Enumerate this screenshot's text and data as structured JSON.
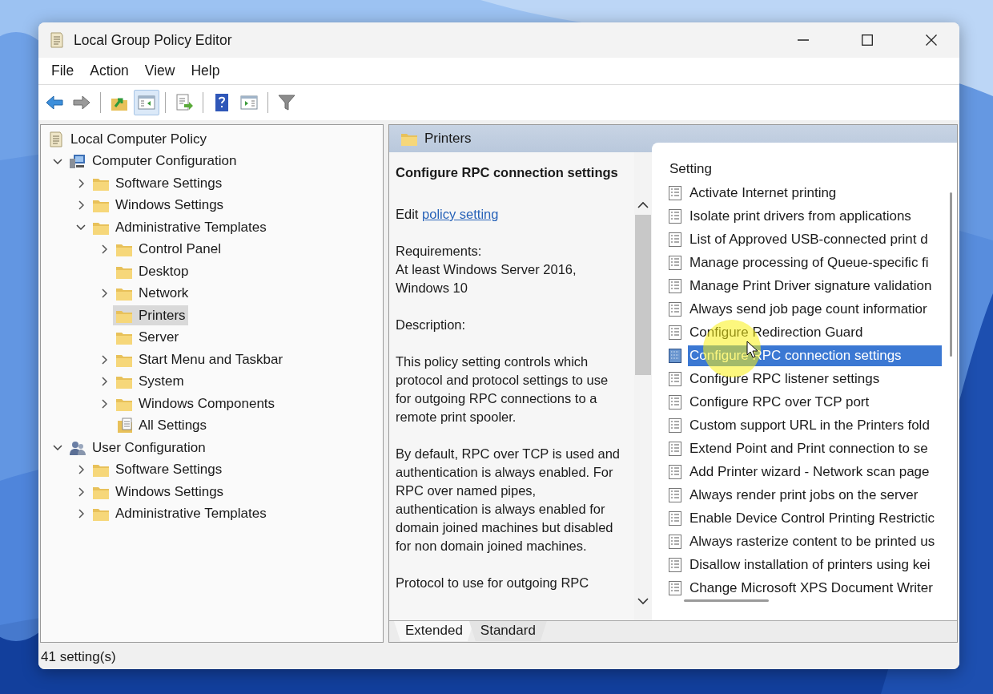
{
  "window": {
    "title": "Local Group Policy Editor"
  },
  "menu": [
    "File",
    "Action",
    "View",
    "Help"
  ],
  "toolbar": [
    [
      {
        "kind": "back",
        "pressed": false
      },
      {
        "kind": "forward",
        "pressed": false
      }
    ],
    [
      {
        "kind": "up",
        "pressed": false
      },
      {
        "kind": "tree",
        "pressed": true
      }
    ],
    [
      {
        "kind": "export",
        "pressed": false
      }
    ],
    [
      {
        "kind": "help",
        "pressed": false
      },
      {
        "kind": "actionpane",
        "pressed": false
      }
    ],
    [
      {
        "kind": "filter",
        "pressed": false
      }
    ]
  ],
  "tree": [
    {
      "label": "Local Computer Policy",
      "kind": "policy",
      "selected": false,
      "children": [
        {
          "label": "Computer Configuration",
          "kind": "computer",
          "expanded": true,
          "selected": false,
          "children": [
            {
              "label": "Software Settings",
              "kind": "folder",
              "expanded": false,
              "selected": false
            },
            {
              "label": "Windows Settings",
              "kind": "folder",
              "expanded": false,
              "selected": false
            },
            {
              "label": "Administrative Templates",
              "kind": "folder",
              "expanded": true,
              "selected": false,
              "children": [
                {
                  "label": "Control Panel",
                  "kind": "folder",
                  "expanded": false,
                  "selected": false
                },
                {
                  "label": "Desktop",
                  "kind": "folder",
                  "selected": false
                },
                {
                  "label": "Network",
                  "kind": "folder",
                  "expanded": false,
                  "selected": false
                },
                {
                  "label": "Printers",
                  "kind": "folder",
                  "selected": true
                },
                {
                  "label": "Server",
                  "kind": "folder",
                  "selected": false
                },
                {
                  "label": "Start Menu and Taskbar",
                  "kind": "folder",
                  "expanded": false,
                  "selected": false
                },
                {
                  "label": "System",
                  "kind": "folder",
                  "expanded": false,
                  "selected": false
                },
                {
                  "label": "Windows Components",
                  "kind": "folder",
                  "expanded": false,
                  "selected": false
                },
                {
                  "label": "All Settings",
                  "kind": "settings",
                  "selected": false
                }
              ]
            }
          ]
        },
        {
          "label": "User Configuration",
          "kind": "user",
          "expanded": true,
          "selected": false,
          "children": [
            {
              "label": "Software Settings",
              "kind": "folder",
              "expanded": false,
              "selected": false
            },
            {
              "label": "Windows Settings",
              "kind": "folder",
              "expanded": false,
              "selected": false
            },
            {
              "label": "Administrative Templates",
              "kind": "folder",
              "expanded": false,
              "selected": false
            }
          ]
        }
      ]
    }
  ],
  "details": {
    "header": "Printers",
    "title": "Configure RPC connection settings",
    "edit_prefix": "Edit",
    "edit_link": "policy setting",
    "paragraphs": [
      [
        "Requirements:",
        "At least Windows Server 2016, Windows 10"
      ],
      [
        "Description:"
      ],
      [
        "This policy setting controls which protocol and protocol settings to use for outgoing RPC connections to a remote print spooler."
      ],
      [
        "By default, RPC over TCP is used and authentication is always enabled. For RPC over named pipes, authentication is always enabled for domain joined machines but disabled for non domain joined machines."
      ],
      [
        "Protocol to use for outgoing RPC"
      ]
    ]
  },
  "settings": {
    "column": "Setting",
    "items": [
      {
        "label": "Activate Internet printing",
        "selected": false
      },
      {
        "label": "Isolate print drivers from applications",
        "selected": false
      },
      {
        "label": "List of Approved USB-connected print d",
        "selected": false
      },
      {
        "label": "Manage processing of Queue-specific fi",
        "selected": false
      },
      {
        "label": "Manage Print Driver signature validation",
        "selected": false
      },
      {
        "label": "Always send job page count informatior",
        "selected": false
      },
      {
        "label": "Configure Redirection Guard",
        "selected": false
      },
      {
        "label": "Configure RPC connection settings",
        "selected": true
      },
      {
        "label": "Configure RPC listener settings",
        "selected": false
      },
      {
        "label": "Configure RPC over TCP port",
        "selected": false
      },
      {
        "label": "Custom support URL in the Printers fold",
        "selected": false
      },
      {
        "label": "Extend Point and Print connection to se",
        "selected": false
      },
      {
        "label": "Add Printer wizard - Network scan page",
        "selected": false
      },
      {
        "label": "Always render print jobs on the server",
        "selected": false
      },
      {
        "label": "Enable Device Control Printing Restrictic",
        "selected": false
      },
      {
        "label": "Always rasterize content to be printed us",
        "selected": false
      },
      {
        "label": "Disallow installation of printers using kei",
        "selected": false
      },
      {
        "label": "Change Microsoft XPS Document Writer",
        "selected": false
      }
    ]
  },
  "tabs": [
    {
      "label": "Extended",
      "selected": true
    },
    {
      "label": "Standard",
      "selected": false
    }
  ],
  "status_bar": "41 setting(s)"
}
